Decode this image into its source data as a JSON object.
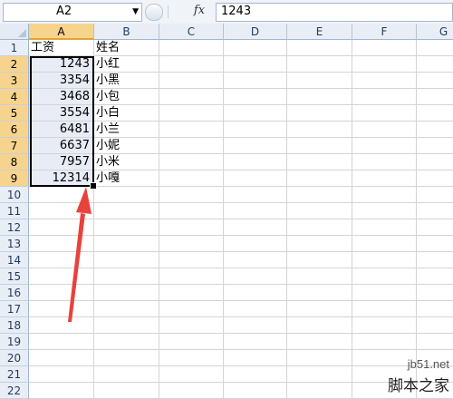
{
  "formula_bar": {
    "name_box": "A2",
    "fx_label": "fx",
    "value": "1243"
  },
  "columns": [
    "A",
    "B",
    "C",
    "D",
    "E",
    "F",
    "G"
  ],
  "selected_column": "A",
  "rows": [
    "1",
    "2",
    "3",
    "4",
    "5",
    "6",
    "7",
    "8",
    "9",
    "10",
    "11",
    "12",
    "13",
    "14",
    "15",
    "16",
    "17",
    "18",
    "19",
    "20",
    "21",
    "22"
  ],
  "selected_rows": [
    "2",
    "3",
    "4",
    "5",
    "6",
    "7",
    "8",
    "9"
  ],
  "cells": {
    "header": {
      "a": "工资",
      "b": "姓名"
    },
    "data": [
      {
        "a": "1243",
        "b": "小红"
      },
      {
        "a": "3354",
        "b": "小黑"
      },
      {
        "a": "3468",
        "b": "小包"
      },
      {
        "a": "3554",
        "b": "小白"
      },
      {
        "a": "6481",
        "b": "小兰"
      },
      {
        "a": "6637",
        "b": "小妮"
      },
      {
        "a": "7957",
        "b": "小米"
      },
      {
        "a": "12314",
        "b": "小嘎"
      }
    ]
  },
  "annotation": {
    "color": "#e8423c",
    "icon": "red-arrow-up"
  },
  "watermark": {
    "line1": "jb51.net",
    "line2": "脚本之家"
  }
}
